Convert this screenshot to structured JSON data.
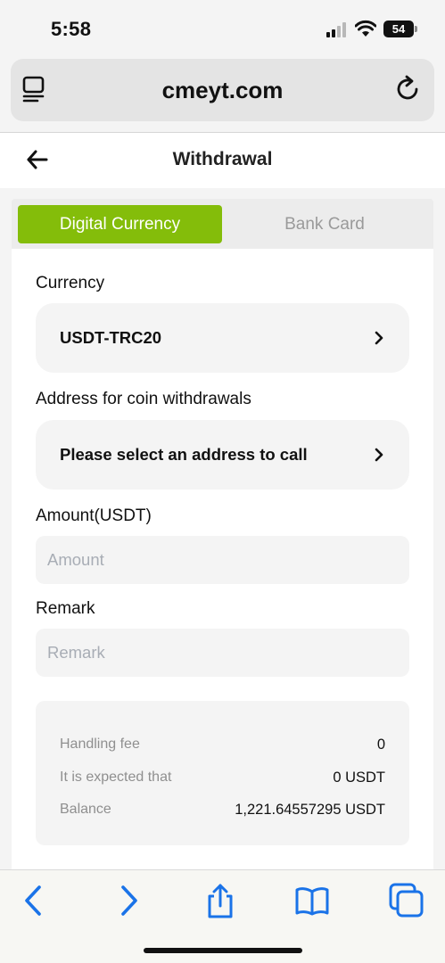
{
  "status_bar": {
    "time": "5:58",
    "battery": "54"
  },
  "browser": {
    "url": "cmeyt.com"
  },
  "page": {
    "title": "Withdrawal"
  },
  "tabs": [
    {
      "label": "Digital Currency",
      "active": true
    },
    {
      "label": "Bank Card",
      "active": false
    }
  ],
  "form": {
    "currency_label": "Currency",
    "currency_value": "USDT-TRC20",
    "address_label": "Address for coin withdrawals",
    "address_value": "Please select an address to call",
    "amount_label": "Amount(USDT)",
    "amount_placeholder": "Amount",
    "remark_label": "Remark",
    "remark_placeholder": "Remark"
  },
  "summary": {
    "fee_label": "Handling fee",
    "fee_value": "0",
    "expected_label": "It is expected that",
    "expected_value": "0 USDT",
    "balance_label": "Balance",
    "balance_value": "1,221.64557295 USDT"
  },
  "colors": {
    "accent": "#84bd0a",
    "ios_blue": "#1a73e8"
  },
  "toolbar_icons": [
    "back-icon",
    "forward-icon",
    "share-icon",
    "bookmarks-icon",
    "tabs-icon"
  ]
}
